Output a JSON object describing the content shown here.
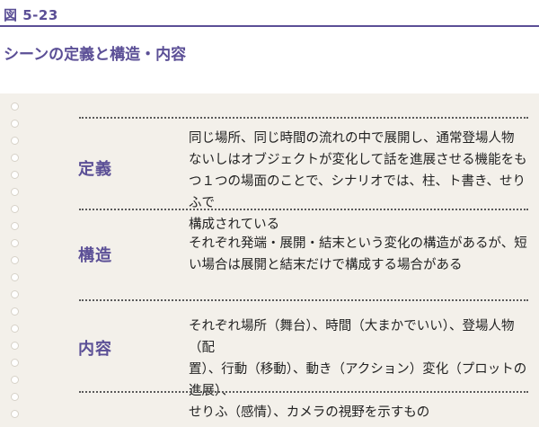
{
  "figure_label": "図 5-23",
  "title": "シーンの定義と構造・内容",
  "rows": [
    {
      "label": "定義",
      "text": "同じ場所、同じ時間の流れの中で展開し、通常登場人物\nないしはオブジェクトが変化して話を進展させる機能をも\nつ１つの場面のことで、シナリオでは、柱、ト書き、せりふで\n構成されている"
    },
    {
      "label": "構造",
      "text": "それぞれ発端・展開・結末という変化の構造があるが、短\nい場合は展開と結末だけで構成する場合がある"
    },
    {
      "label": "内容",
      "text": "それぞれ場所（舞台）、時間（大まかでいい）、登場人物（配\n置）、行動（移動）、動き（アクション）変化（プロットの進展）、\nせりふ（感情）、カメラの視野を示すもの"
    }
  ]
}
